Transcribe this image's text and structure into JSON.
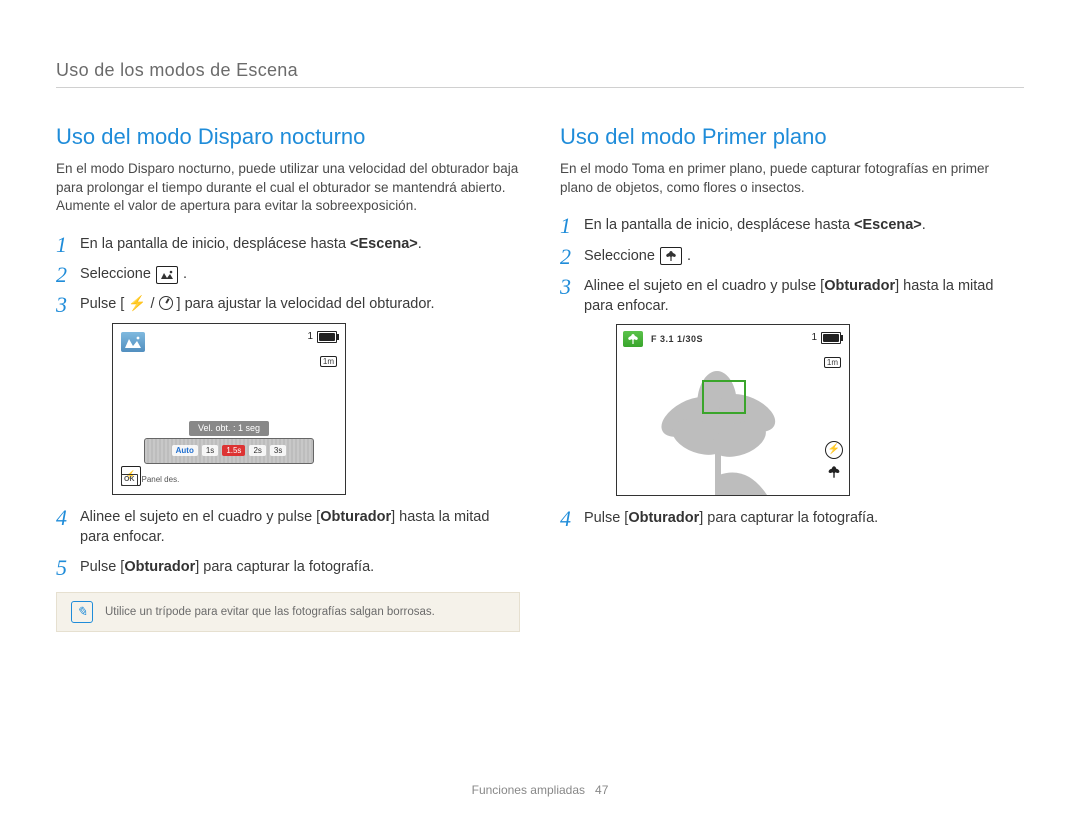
{
  "breadcrumb": "Uso de los modos de Escena",
  "left": {
    "title": "Uso del modo Disparo nocturno",
    "intro": "En el modo Disparo nocturno, puede utilizar una velocidad del obturador baja para prolongar el tiempo durante el cual el obturador se mantendrá abierto. Aumente el valor de apertura para evitar la sobreexposición.",
    "steps": {
      "s1_a": "En la pantalla de inicio, desplácese hasta ",
      "s1_b": "<Escena>",
      "s1_c": ".",
      "s2": "Seleccione ",
      "s2_icon": "night-mode-icon",
      "s3": "Pulse [ ",
      "s3_mid": " / ",
      "s3_end": " ] para ajustar la velocidad del obturador.",
      "s4_a": "Alinee el sujeto en el cuadro y pulse [",
      "s4_b": "Obturador",
      "s4_c": "] hasta la mitad para enfocar.",
      "s5_a": "Pulse [",
      "s5_b": "Obturador",
      "s5_c": "] para capturar la fotografía."
    },
    "screen": {
      "shutter_label": "Vel. obt. : 1 seg",
      "marks": [
        "Auto",
        "1s",
        "1.5s",
        "2s",
        "3s"
      ],
      "badge_1": "1",
      "badge_1m": "1m",
      "panel_des": "Panel des.",
      "ok": "OK"
    },
    "tip": "Utilice un trípode para evitar que las fotografías salgan borrosas."
  },
  "right": {
    "title": "Uso del modo Primer plano",
    "intro": "En el modo Toma en primer plano, puede capturar fotografías en primer plano de objetos, como flores o insectos.",
    "steps": {
      "s1_a": "En la pantalla de inicio, desplácese hasta ",
      "s1_b": "<Escena>",
      "s1_c": ".",
      "s2": "Seleccione ",
      "s2_icon": "closeup-mode-icon",
      "s3_a": "Alinee el sujeto en el cuadro y pulse [",
      "s3_b": "Obturador",
      "s3_c": "] hasta la mitad para enfocar.",
      "s4_a": "Pulse [",
      "s4_b": "Obturador",
      "s4_c": "] para capturar la fotografía."
    },
    "screen": {
      "exposure": "F 3.1 1/30S",
      "badge_1": "1",
      "badge_1m": "1m"
    }
  },
  "footer": {
    "section": "Funciones ampliadas",
    "page": "47"
  }
}
